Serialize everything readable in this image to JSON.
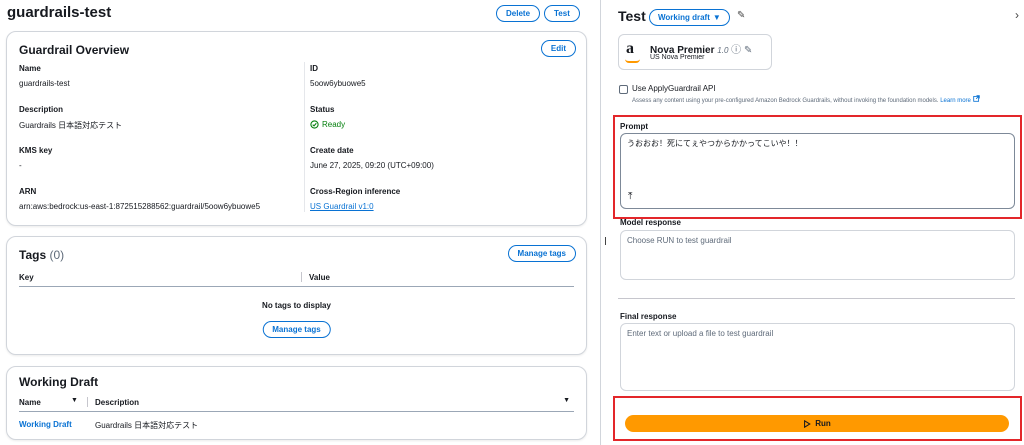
{
  "page": {
    "title": "guardrails-test",
    "delete_label": "Delete",
    "test_label": "Test"
  },
  "overview": {
    "title": "Guardrail Overview",
    "edit_label": "Edit",
    "name_label": "Name",
    "name_value": "guardrails-test",
    "description_label": "Description",
    "description_value": "Guardrails 日本語対応テスト",
    "kms_label": "KMS key",
    "kms_value": "-",
    "arn_label": "ARN",
    "arn_value": "arn:aws:bedrock:us-east-1:872515288562:guardrail/5oow6ybuowe5",
    "id_label": "ID",
    "id_value": "5oow6ybuowe5",
    "status_label": "Status",
    "status_value": "Ready",
    "create_label": "Create date",
    "create_value": "June 27, 2025, 09:20 (UTC+09:00)",
    "cri_label": "Cross-Region inference",
    "cri_value": "US Guardrail v1:0"
  },
  "tags": {
    "title": "Tags",
    "count": "(0)",
    "manage_label": "Manage tags",
    "col_key": "Key",
    "col_value": "Value",
    "empty": "No tags to display"
  },
  "working_draft": {
    "title": "Working Draft",
    "col_name": "Name",
    "col_description": "Description",
    "row_name": "Working Draft",
    "row_description": "Guardrails 日本語対応テスト"
  },
  "test_panel": {
    "title": "Test",
    "version_label": "Working draft",
    "model_name": "Nova Premier",
    "model_version": "1.0",
    "model_sub": "US Nova Premier",
    "apply_label": "Use ApplyGuardrail API",
    "apply_desc": "Assess any content using your pre-configured Amazon Bedrock Guardrails, without invoking the foundation models.",
    "learn_more": "Learn more",
    "prompt_label": "Prompt",
    "prompt_value": "うおおお！死にてぇやつからかかってこいや！！",
    "model_response_label": "Model response",
    "model_response_placeholder": "Choose RUN to test guardrail",
    "final_response_label": "Final response",
    "final_response_placeholder": "Enter text or upload a file to test guardrail",
    "run_label": "Run"
  },
  "colors": {
    "accent": "#0972d3",
    "run": "#ff9900",
    "highlight": "#e3262a",
    "success": "#037f0c"
  }
}
